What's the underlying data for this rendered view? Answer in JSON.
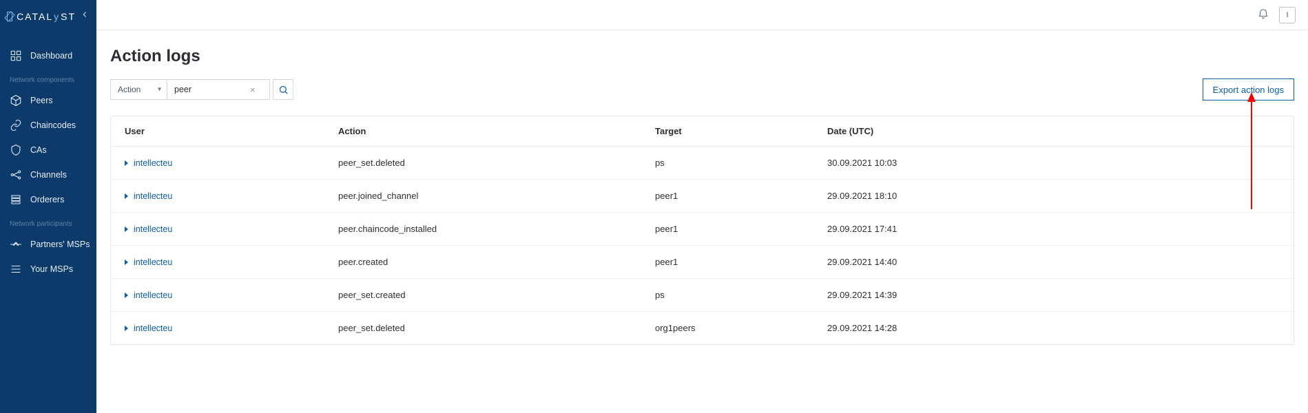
{
  "brand": {
    "name": "CATALYST",
    "y_char": "y"
  },
  "topbar": {
    "avatar_initial": "I"
  },
  "page": {
    "title": "Action logs"
  },
  "filter": {
    "selected_label": "Action",
    "search_value": "peer"
  },
  "buttons": {
    "export": "Export action logs"
  },
  "sidebar": {
    "sections": [
      {
        "label": "",
        "items": [
          {
            "label": "Dashboard",
            "icon": "dashboard"
          }
        ]
      },
      {
        "label": "Network components",
        "items": [
          {
            "label": "Peers",
            "icon": "cube"
          },
          {
            "label": "Chaincodes",
            "icon": "link"
          },
          {
            "label": "CAs",
            "icon": "shield"
          },
          {
            "label": "Channels",
            "icon": "network"
          },
          {
            "label": "Orderers",
            "icon": "stack"
          }
        ]
      },
      {
        "label": "Network participants",
        "items": [
          {
            "label": "Partners' MSPs",
            "icon": "handshake"
          },
          {
            "label": "Your MSPs",
            "icon": "list"
          }
        ]
      }
    ]
  },
  "table": {
    "columns": [
      "User",
      "Action",
      "Target",
      "Date (UTC)"
    ],
    "rows": [
      {
        "user": "intellecteu",
        "action": "peer_set.deleted",
        "target": "ps",
        "date": "30.09.2021 10:03"
      },
      {
        "user": "intellecteu",
        "action": "peer.joined_channel",
        "target": "peer1",
        "date": "29.09.2021 18:10"
      },
      {
        "user": "intellecteu",
        "action": "peer.chaincode_installed",
        "target": "peer1",
        "date": "29.09.2021 17:41"
      },
      {
        "user": "intellecteu",
        "action": "peer.created",
        "target": "peer1",
        "date": "29.09.2021 14:40"
      },
      {
        "user": "intellecteu",
        "action": "peer_set.created",
        "target": "ps",
        "date": "29.09.2021 14:39"
      },
      {
        "user": "intellecteu",
        "action": "peer_set.deleted",
        "target": "org1peers",
        "date": "29.09.2021 14:28"
      }
    ]
  }
}
